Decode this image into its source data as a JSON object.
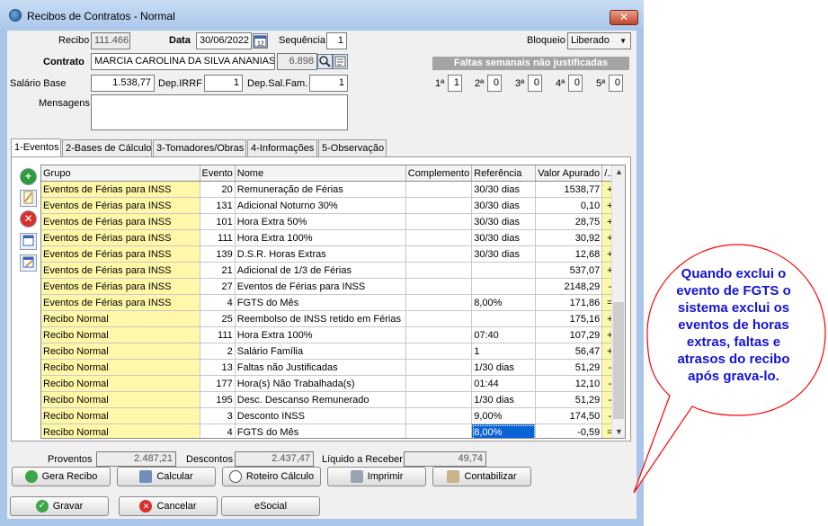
{
  "window": {
    "title": "Recibos de Contratos - Normal",
    "close": "✕"
  },
  "header": {
    "recibo_label": "Recibo",
    "recibo_value": "111.466",
    "data_label": "Data",
    "data_value": "30/06/2022",
    "sequencia_label": "Sequência",
    "sequencia_value": "1",
    "bloqueio_label": "Bloqueio",
    "bloqueio_value": "Liberado",
    "contrato_label": "Contrato",
    "contrato_value": "MARCIA CAROLINA DA SILVA ANANIAS",
    "contrato_code": "6.898",
    "salario_label": "Salário Base",
    "salario_value": "1.538,77",
    "depirrf_label": "Dep.IRRF",
    "depirrf_value": "1",
    "depsal_label": "Dep.Sal.Fam.",
    "depsal_value": "1",
    "mensagens_label": "Mensagens"
  },
  "faltas": {
    "title": "Faltas semanais não justificadas",
    "weeks": [
      {
        "label": "1ª",
        "value": "1"
      },
      {
        "label": "2ª",
        "value": "0"
      },
      {
        "label": "3ª",
        "value": "0"
      },
      {
        "label": "4ª",
        "value": "0"
      },
      {
        "label": "5ª",
        "value": "0"
      }
    ]
  },
  "tabs": [
    "1-Eventos",
    "2-Bases de Cálculo",
    "3-Tomadores/Obras",
    "4-Informações",
    "5-Observação"
  ],
  "grid": {
    "columns": [
      "Grupo",
      "Evento",
      "Nome",
      "Complemento",
      "Referência",
      "Valor Apurado",
      "/..."
    ],
    "rows": [
      {
        "grupo": "Eventos de Férias para INSS",
        "evento": "20",
        "nome": "Remuneração de Férias",
        "complemento": "",
        "referencia": "30/30 dias",
        "valor": "1538,77",
        "sinal": "+"
      },
      {
        "grupo": "Eventos de Férias para INSS",
        "evento": "131",
        "nome": "Adicional Noturno 30%",
        "complemento": "",
        "referencia": "30/30 dias",
        "valor": "0,10",
        "sinal": "+"
      },
      {
        "grupo": "Eventos de Férias para INSS",
        "evento": "101",
        "nome": "Hora Extra 50%",
        "complemento": "",
        "referencia": "30/30 dias",
        "valor": "28,75",
        "sinal": "+"
      },
      {
        "grupo": "Eventos de Férias para INSS",
        "evento": "111",
        "nome": "Hora Extra 100%",
        "complemento": "",
        "referencia": "30/30 dias",
        "valor": "30,92",
        "sinal": "+"
      },
      {
        "grupo": "Eventos de Férias para INSS",
        "evento": "139",
        "nome": "D.S.R. Horas Extras",
        "complemento": "",
        "referencia": "30/30 dias",
        "valor": "12,68",
        "sinal": "+"
      },
      {
        "grupo": "Eventos de Férias para INSS",
        "evento": "21",
        "nome": "Adicional de 1/3 de Férias",
        "complemento": "",
        "referencia": "",
        "valor": "537,07",
        "sinal": "+"
      },
      {
        "grupo": "Eventos de Férias para INSS",
        "evento": "27",
        "nome": "Eventos de Férias para INSS",
        "complemento": "",
        "referencia": "",
        "valor": "2148,29",
        "sinal": "-"
      },
      {
        "grupo": "Eventos de Férias para INSS",
        "evento": "4",
        "nome": "FGTS do Mês",
        "complemento": "",
        "referencia": "8,00%",
        "valor": "171,86",
        "sinal": "="
      },
      {
        "grupo": "Recibo Normal",
        "evento": "25",
        "nome": "Reembolso de INSS retido em Férias",
        "complemento": "",
        "referencia": "",
        "valor": "175,16",
        "sinal": "+"
      },
      {
        "grupo": "Recibo Normal",
        "evento": "111",
        "nome": "Hora Extra 100%",
        "complemento": "",
        "referencia": "07:40",
        "valor": "107,29",
        "sinal": "+"
      },
      {
        "grupo": "Recibo Normal",
        "evento": "2",
        "nome": "Salário Família",
        "complemento": "",
        "referencia": "1",
        "valor": "56,47",
        "sinal": "+"
      },
      {
        "grupo": "Recibo Normal",
        "evento": "13",
        "nome": "Faltas não Justificadas",
        "complemento": "",
        "referencia": "1/30 dias",
        "valor": "51,29",
        "sinal": "-"
      },
      {
        "grupo": "Recibo Normal",
        "evento": "177",
        "nome": "Hora(s) Não Trabalhada(s)",
        "complemento": "",
        "referencia": "01:44",
        "valor": "12,10",
        "sinal": "-"
      },
      {
        "grupo": "Recibo Normal",
        "evento": "195",
        "nome": "Desc. Descanso Remunerado",
        "complemento": "",
        "referencia": "1/30 dias",
        "valor": "51,29",
        "sinal": "-"
      },
      {
        "grupo": "Recibo Normal",
        "evento": "3",
        "nome": "Desconto INSS",
        "complemento": "",
        "referencia": "9,00%",
        "valor": "174,50",
        "sinal": "-"
      },
      {
        "grupo": "Recibo Normal",
        "evento": "4",
        "nome": "FGTS do Mês",
        "complemento": "",
        "referencia": "8,00%",
        "valor": "-0,59",
        "sinal": "="
      }
    ]
  },
  "totals": {
    "proventos_label": "Proventos",
    "proventos_value": "2.487,21",
    "descontos_label": "Descontos",
    "descontos_value": "2.437,47",
    "liquido_label": "Líquido a Receber",
    "liquido_value": "49,74"
  },
  "actions": {
    "gera_recibo": "Gera Recibo",
    "calcular": "Calcular",
    "roteiro": "Roteiro Cálculo",
    "imprimir": "Imprimir",
    "contabilizar": "Contabilizar",
    "gravar": "Gravar",
    "cancelar": "Cancelar",
    "esocial": "eSocial"
  },
  "callout": {
    "text": "Quando exclui o evento de FGTS o sistema exclui os eventos de horas extras, faltas e atrasos do recibo após grava-lo.",
    "color": "#1414d8",
    "border_color": "#ff0000"
  }
}
